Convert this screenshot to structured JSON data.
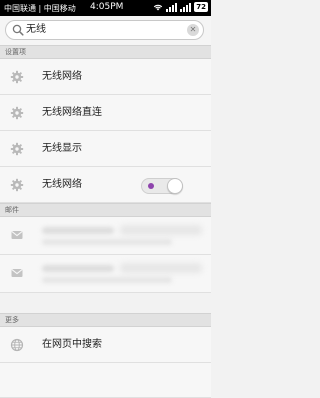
{
  "status_bar": {
    "carrier": "中国联通 | 中国移动",
    "time": "4:05PM",
    "battery": "72"
  },
  "search": {
    "query": "无线",
    "placeholder": ""
  },
  "sections": {
    "settings_header": "设置项",
    "mail_header": "邮件",
    "more_header": "更多"
  },
  "settings_items": [
    {
      "label": "无线网络",
      "icon": "gear-icon"
    },
    {
      "label": "无线网络直连",
      "icon": "gear-icon"
    },
    {
      "label": "无线显示",
      "icon": "gear-icon"
    },
    {
      "label": "无线网络",
      "icon": "gear-icon",
      "toggle_state": "on"
    }
  ],
  "mail_items": [
    {
      "icon": "envelope-icon"
    },
    {
      "icon": "envelope-icon"
    }
  ],
  "more_items": [
    {
      "label": "在网页中搜索",
      "icon": "globe-icon"
    }
  ],
  "colors": {
    "toggle_accent": "#8e44ad",
    "status_bar_bg": "#000000",
    "section_bg": "#e2e2e2"
  }
}
